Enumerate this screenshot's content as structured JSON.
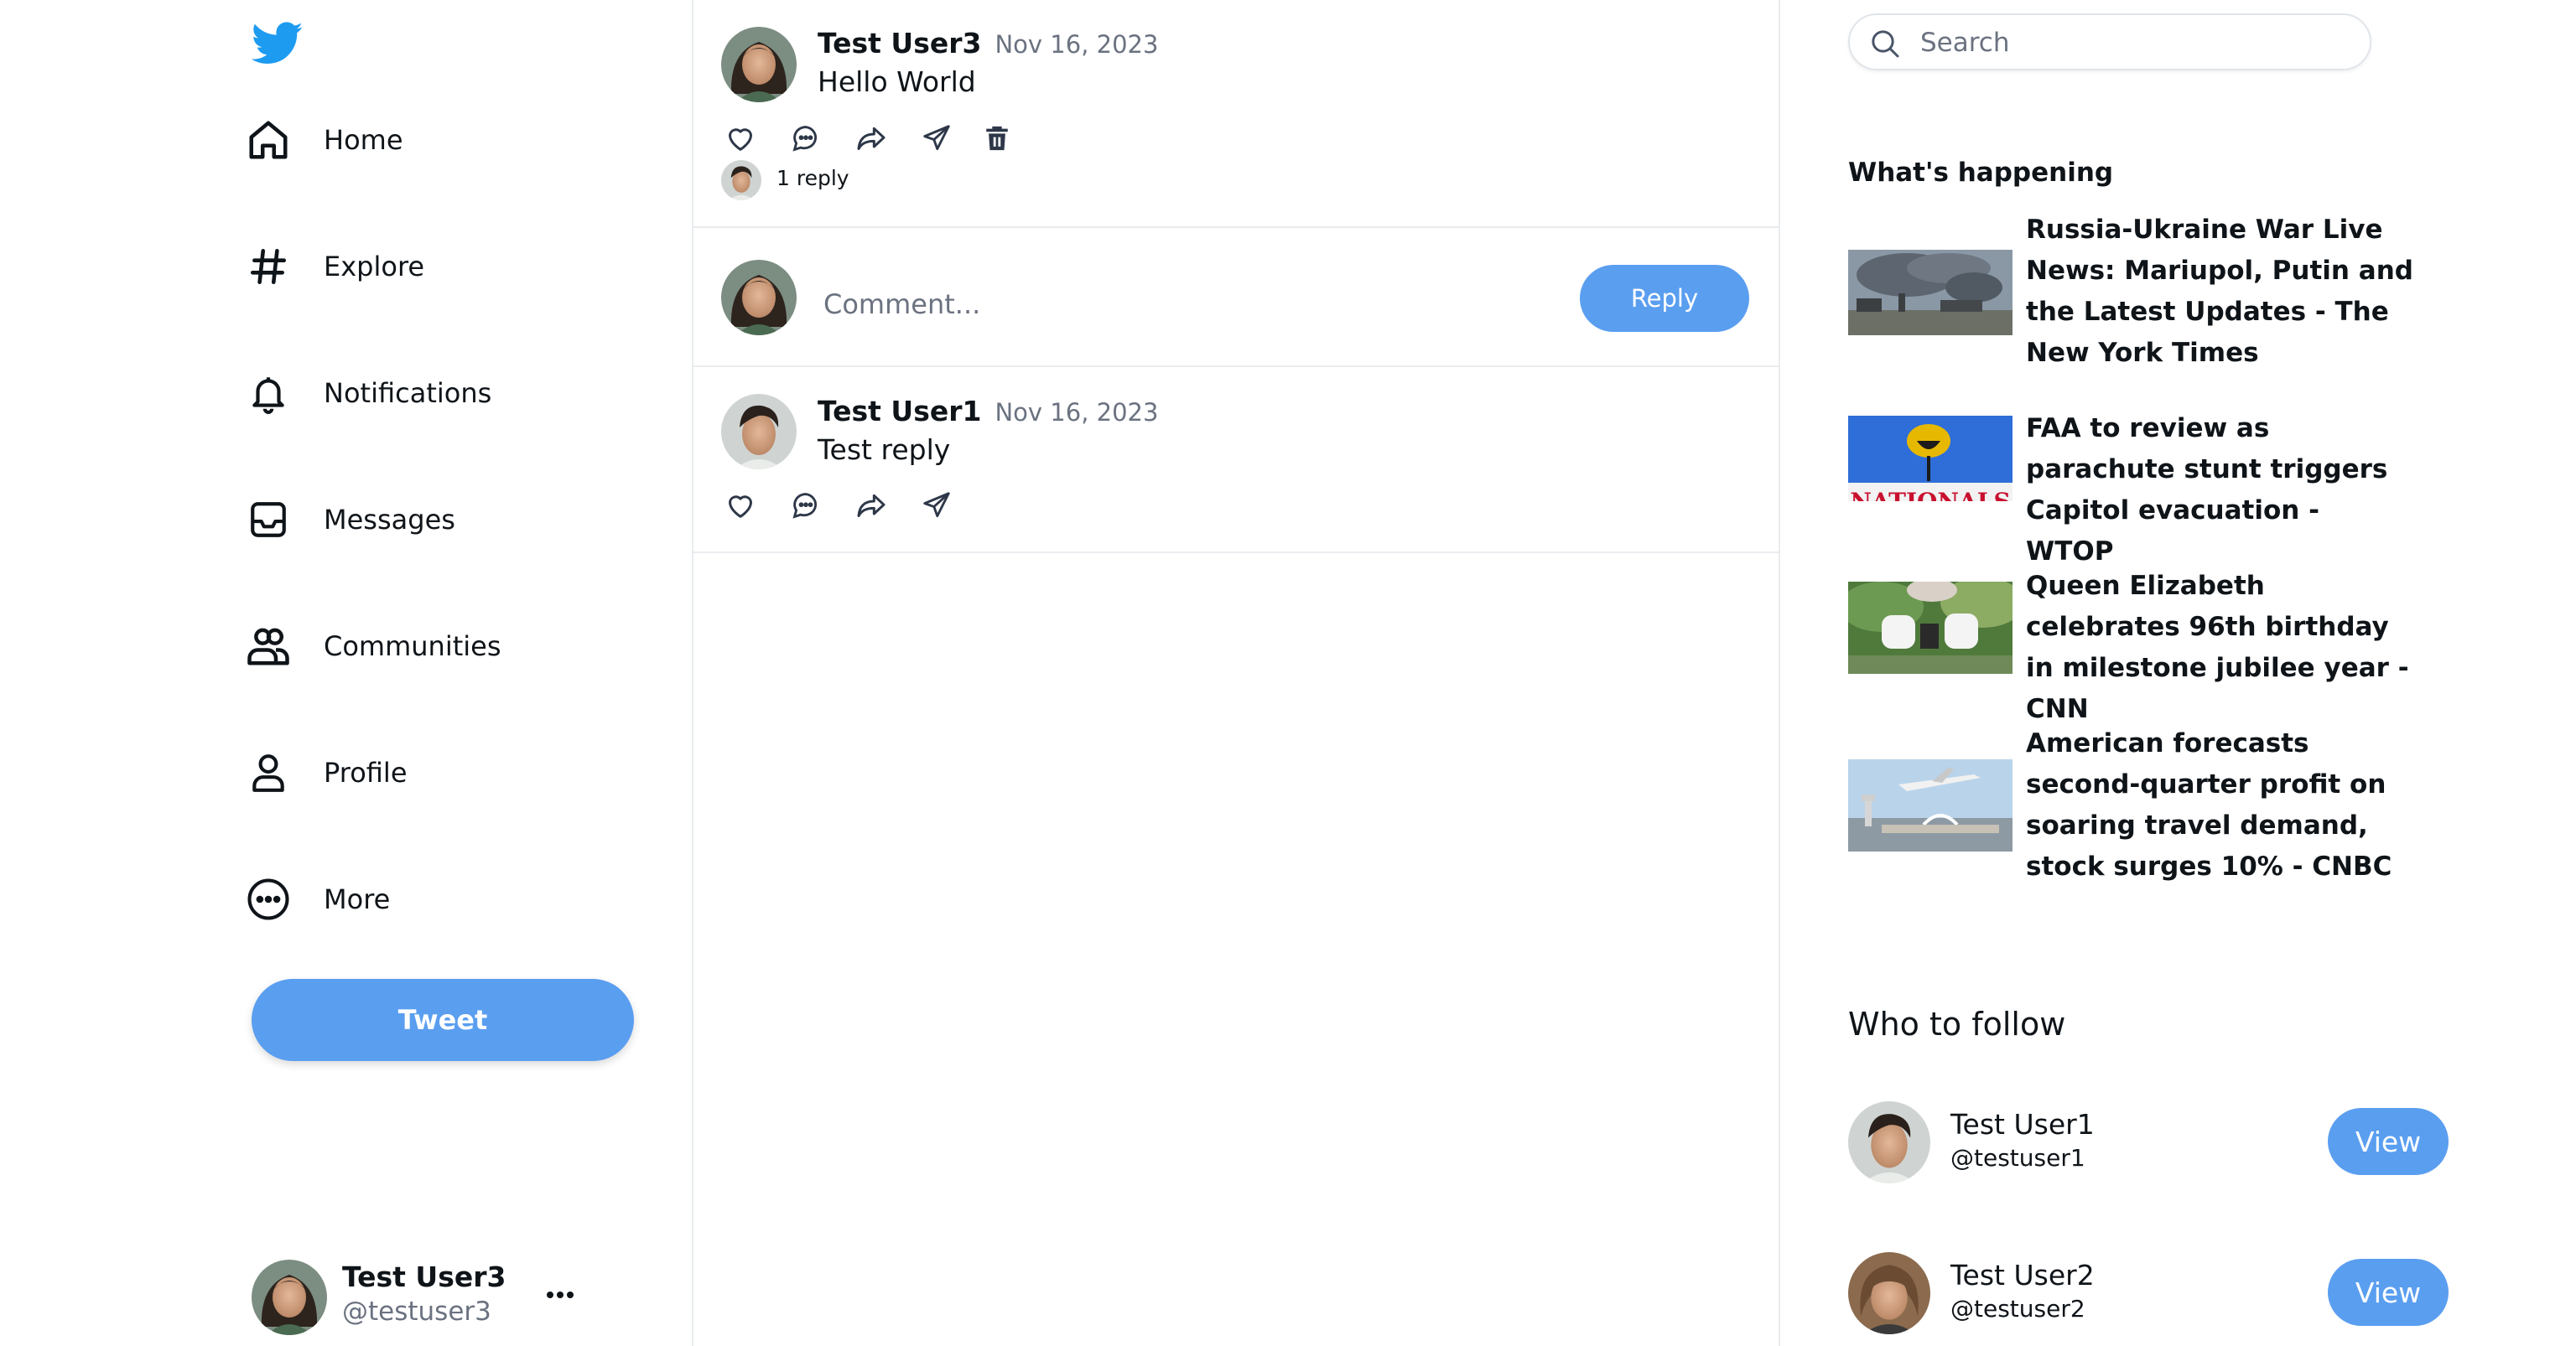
{
  "sidebar": {
    "logo_icon": "twitter-bird-icon",
    "nav": [
      {
        "label": "Home",
        "icon": "home-icon"
      },
      {
        "label": "Explore",
        "icon": "hashtag-icon"
      },
      {
        "label": "Notifications",
        "icon": "bell-icon"
      },
      {
        "label": "Messages",
        "icon": "inbox-icon"
      },
      {
        "label": "Communities",
        "icon": "users-icon"
      },
      {
        "label": "Profile",
        "icon": "user-icon"
      },
      {
        "label": "More",
        "icon": "more-circle-icon"
      }
    ],
    "tweet_label": "Tweet",
    "account": {
      "name": "Test User3",
      "handle": "@testuser3",
      "menu_icon": "ellipsis-icon"
    }
  },
  "thread": {
    "post": {
      "name": "Test User3",
      "date": "Nov 16, 2023",
      "text": "Hello World",
      "replies_label": "1 reply",
      "actions": [
        "heart-icon",
        "comment-icon",
        "share-icon",
        "send-icon",
        "trash-icon"
      ]
    },
    "composer": {
      "placeholder": "Comment...",
      "button_label": "Reply"
    },
    "reply": {
      "name": "Test User1",
      "date": "Nov 16, 2023",
      "text": "Test reply",
      "actions": [
        "heart-icon",
        "comment-icon",
        "share-icon",
        "send-icon"
      ]
    }
  },
  "right": {
    "search": {
      "placeholder": "Search",
      "icon": "search-icon"
    },
    "happening_title": "What's happening",
    "news": [
      {
        "title": "Russia-Ukraine War Live News: Mariupol, Putin and the Latest Updates - The New York Times"
      },
      {
        "title": "FAA to review as parachute stunt triggers Capitol evacuation - WTOP",
        "image_text": "NATIONALS"
      },
      {
        "title": "Queen Elizabeth celebrates 96th birthday in milestone jubilee year - CNN"
      },
      {
        "title": "American forecasts second-quarter profit on soaring travel demand, stock surges 10% - CNBC"
      }
    ],
    "follow_title": "Who to follow",
    "follow": [
      {
        "name": "Test User1",
        "handle": "@testuser1",
        "button": "View"
      },
      {
        "name": "Test User2",
        "handle": "@testuser2",
        "button": "View"
      }
    ]
  },
  "colors": {
    "accent": "#5a9ef0",
    "twitter_blue": "#1d9bf0",
    "divider": "#e9ecef",
    "muted": "#6b7280"
  }
}
